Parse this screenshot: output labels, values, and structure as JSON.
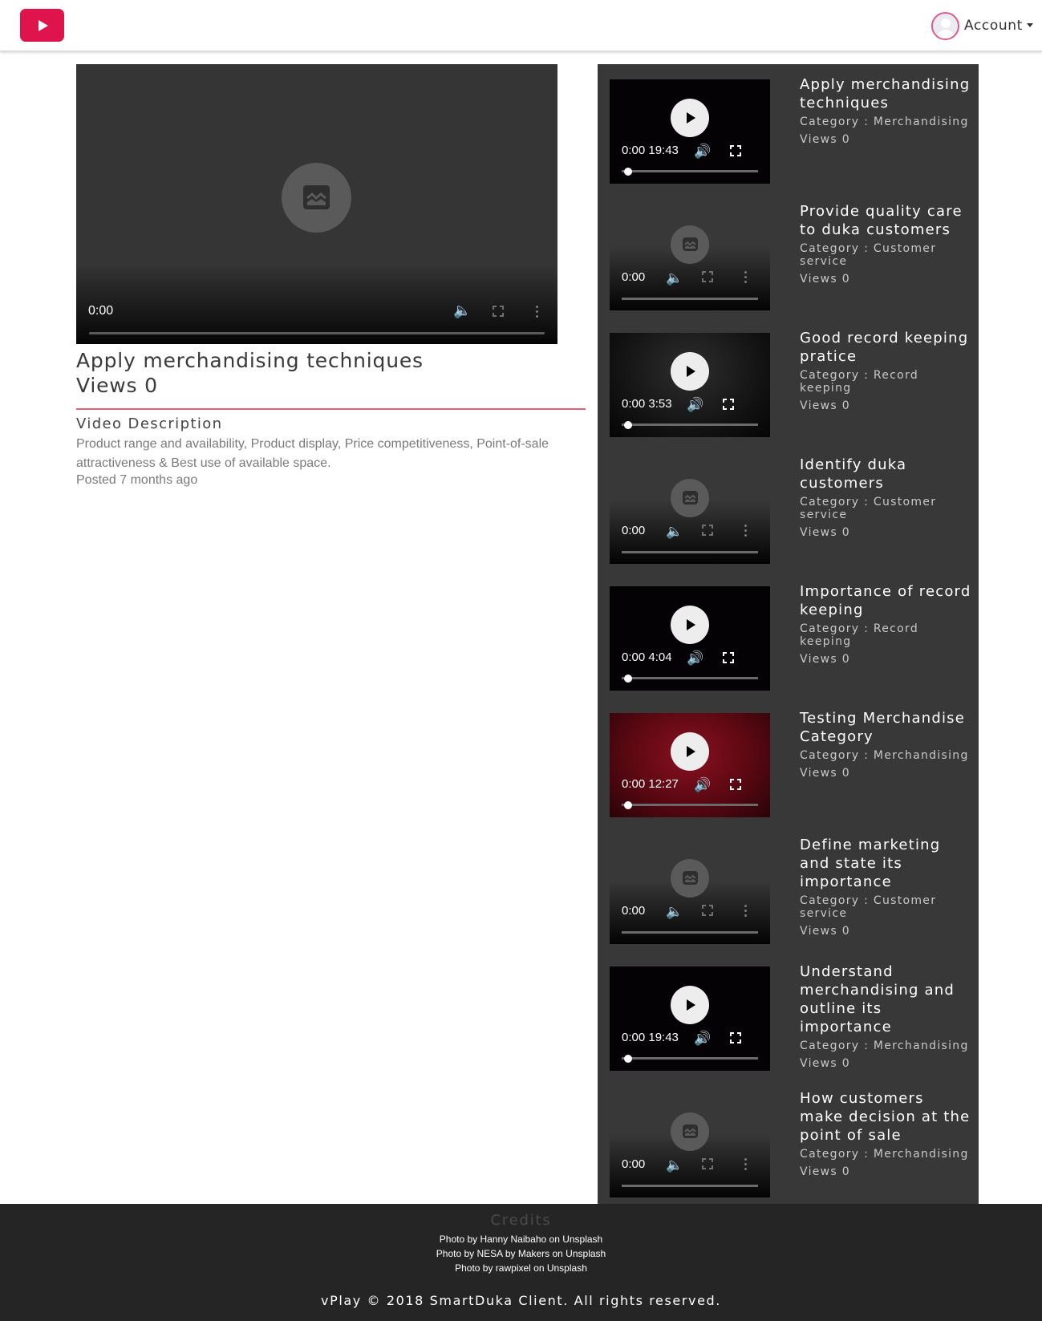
{
  "nav": {
    "logo_icon": "play-icon",
    "brand_color": "#e0144c",
    "account_label": "Account"
  },
  "player": {
    "time": "0:00",
    "title": "Apply merchandising techniques",
    "views": "Views 0",
    "description_heading": "Video Description",
    "description": "Product range and availability, Product display, Price competitiveness, Point-of-sale attractiveness & Best use of available space.",
    "posted": "Posted 7 months ago"
  },
  "playlist": [
    {
      "title": "Apply merchandising techniques",
      "category": "Category : Merchandising",
      "views": "Views 0",
      "time": "0:00 19:43",
      "state": "loaded"
    },
    {
      "title": "Provide quality care to duka customers",
      "category": "Category : Customer service",
      "views": "Views 0",
      "time": "0:00",
      "state": "broken"
    },
    {
      "title": "Good record keeping pratice",
      "category": "Category : Record keeping",
      "views": "Views 0",
      "time": "0:00 3:53",
      "state": "loaded"
    },
    {
      "title": "Identify duka customers",
      "category": "Category : Customer service",
      "views": "Views 0",
      "time": "0:00",
      "state": "broken"
    },
    {
      "title": "Importance of record keeping",
      "category": "Category : Record keeping",
      "views": "Views 0",
      "time": "0:00 4:04",
      "state": "loaded"
    },
    {
      "title": "Testing Merchandise Category",
      "category": "Category : Merchandising",
      "views": "Views 0",
      "time": "0:00 12:27",
      "state": "loaded"
    },
    {
      "title": "Define marketing and state its importance",
      "category": "Category : Customer service",
      "views": "Views 0",
      "time": "0:00",
      "state": "broken"
    },
    {
      "title": "Understand merchandising and outline its importance",
      "category": "Category : Merchandising",
      "views": "Views 0",
      "time": "0:00 19:43",
      "state": "loaded"
    },
    {
      "title": "How customers make decision at the point of sale",
      "category": "Category : Merchandising",
      "views": "Views 0",
      "time": "0:00",
      "state": "broken"
    }
  ],
  "footer": {
    "credits_title": "Credits",
    "credits": [
      "Photo by Hanny Naibaho on Unsplash",
      "Photo by NESA by Makers on Unsplash",
      "Photo by rawpixel on Unsplash"
    ],
    "copyright": "vPlay © 2018 SmartDuka Client. All rights reserved."
  }
}
